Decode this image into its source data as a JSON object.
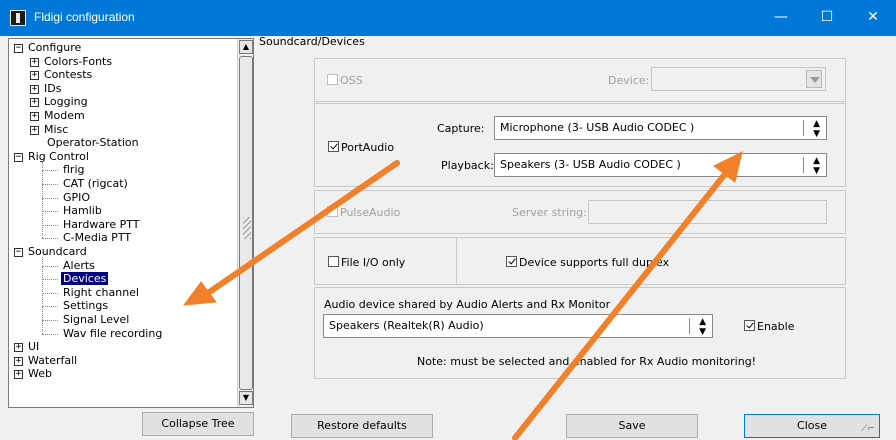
{
  "window": {
    "title": "Fldigi configuration",
    "controls": {
      "minimize": "—",
      "maximize": "☐",
      "close": "✕"
    }
  },
  "tree": {
    "items": [
      {
        "label": "Configure",
        "expander": "−"
      },
      {
        "label": "Colors-Fonts",
        "expander": "+"
      },
      {
        "label": "Contests",
        "expander": "+"
      },
      {
        "label": "IDs",
        "expander": "+"
      },
      {
        "label": "Logging",
        "expander": "+"
      },
      {
        "label": "Modem",
        "expander": "+"
      },
      {
        "label": "Misc",
        "expander": "+"
      },
      {
        "label": "Operator-Station",
        "expander": ""
      },
      {
        "label": "Rig Control",
        "expander": "−"
      },
      {
        "label": "flrig",
        "expander": ""
      },
      {
        "label": "CAT (rigcat)",
        "expander": ""
      },
      {
        "label": "GPIO",
        "expander": ""
      },
      {
        "label": "Hamlib",
        "expander": ""
      },
      {
        "label": "Hardware PTT",
        "expander": ""
      },
      {
        "label": "C-Media PTT",
        "expander": ""
      },
      {
        "label": "Soundcard",
        "expander": "−"
      },
      {
        "label": "Alerts",
        "expander": ""
      },
      {
        "label": "Devices",
        "expander": "",
        "selected": true
      },
      {
        "label": "Right channel",
        "expander": ""
      },
      {
        "label": "Settings",
        "expander": ""
      },
      {
        "label": "Signal Level",
        "expander": ""
      },
      {
        "label": "Wav file recording",
        "expander": ""
      },
      {
        "label": "UI",
        "expander": "+"
      },
      {
        "label": "Waterfall",
        "expander": "+"
      },
      {
        "label": "Web",
        "expander": "+"
      }
    ],
    "scroll_up": "▲",
    "scroll_down": "▼"
  },
  "section_title": "Soundcard/Devices",
  "oss": {
    "label": "OSS",
    "device_label": "Device:",
    "checked": false,
    "enabled": false
  },
  "portaudio": {
    "label": "PortAudio",
    "checked": true,
    "capture_label": "Capture:",
    "capture_value": "Microphone (3- USB Audio CODEC )",
    "playback_label": "Playback:",
    "playback_value": "Speakers (3- USB Audio CODEC )"
  },
  "pulseaudio": {
    "label": "PulseAudio",
    "server_label": "Server string:",
    "checked": false,
    "enabled": false
  },
  "fileio": {
    "label": "File I/O only",
    "checked": false
  },
  "full_duplex": {
    "label": "Device supports full duplex",
    "checked": true
  },
  "alerts": {
    "label": "Audio device shared by Audio Alerts and Rx Monitor",
    "device_value": "Speakers (Realtek(R) Audio)",
    "enable_label": "Enable",
    "enable_checked": true,
    "note": "Note: must be selected and enabled for Rx Audio monitoring!"
  },
  "buttons": {
    "collapse_tree": "Collapse Tree",
    "restore_defaults": "Restore defaults",
    "save": "Save",
    "close": "Close"
  },
  "combo_glyph": "▲\n▼",
  "colors": {
    "titlebar": "#0078d7",
    "selection": "#000080",
    "annotation_arrow": "#f0802a"
  },
  "icons": {
    "app": "fldigi-app-icon",
    "resize": "resize-grip-icon"
  }
}
